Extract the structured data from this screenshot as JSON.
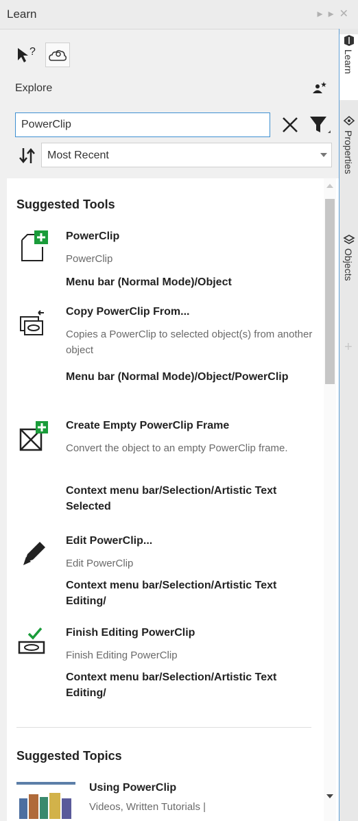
{
  "panel": {
    "title": "Learn",
    "explore_label": "Explore",
    "search": {
      "value": "PowerClip",
      "placeholder": ""
    },
    "sort": {
      "selected": "Most Recent"
    }
  },
  "tools_section": {
    "title": "Suggested Tools",
    "items": [
      {
        "name": "PowerClip",
        "desc": "PowerClip",
        "path": "Menu bar (Normal Mode)/Object"
      },
      {
        "name": "Copy PowerClip From...",
        "desc": "Copies a PowerClip to selected object(s) from another object",
        "path": "Menu bar (Normal Mode)/Object/PowerClip"
      },
      {
        "name": "Create Empty PowerClip Frame",
        "desc": "Convert the object to an empty PowerClip frame.",
        "path": "Context menu bar/Selection/Artistic Text Selected"
      },
      {
        "name": "Edit PowerClip...",
        "desc": "Edit PowerClip",
        "path": "Context menu bar/Selection/Artistic Text Editing/"
      },
      {
        "name": "Finish Editing PowerClip",
        "desc": "Finish Editing PowerClip",
        "path": "Context menu bar/Selection/Artistic Text Editing/"
      }
    ]
  },
  "topics_section": {
    "title": "Suggested Topics",
    "items": [
      {
        "title": "Using PowerClip",
        "meta": "Videos, Written Tutorials |"
      }
    ]
  },
  "side_tabs": [
    {
      "label": "Learn",
      "icon": "learn-icon"
    },
    {
      "label": "Properties",
      "icon": "properties-icon"
    },
    {
      "label": "Objects",
      "icon": "objects-icon"
    }
  ],
  "colors": {
    "accent": "#3d8fd1",
    "plus_green": "#1a9c3a"
  }
}
